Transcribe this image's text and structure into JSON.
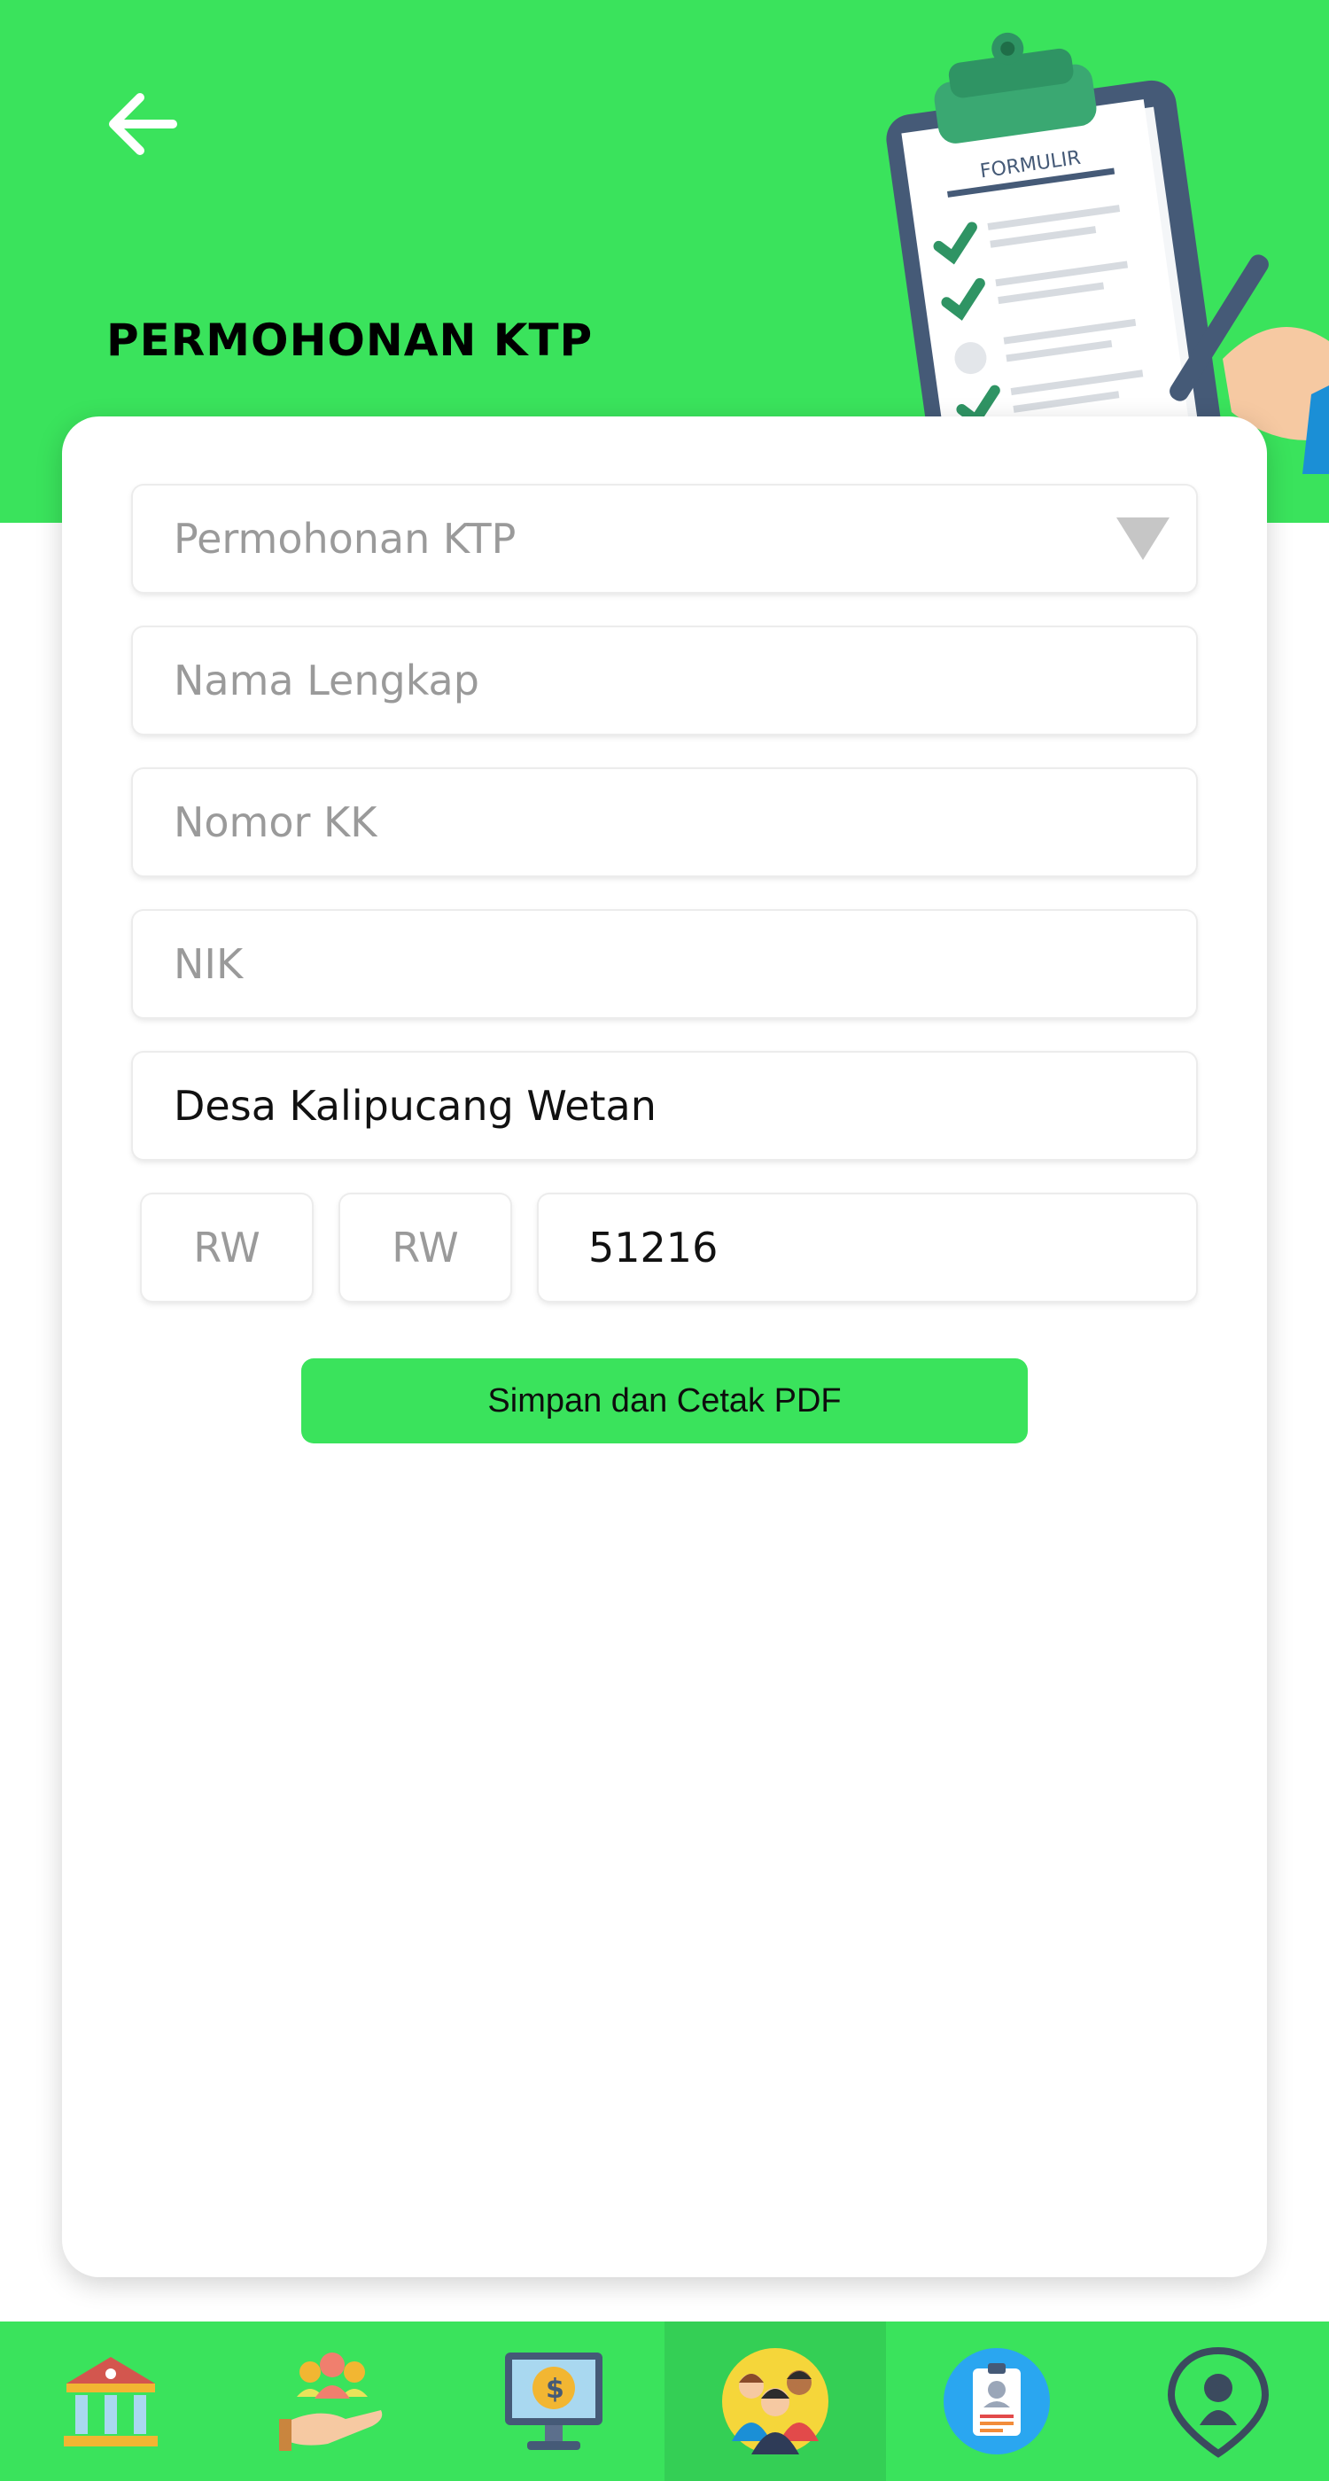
{
  "header": {
    "title": "PERMOHONAN KTP",
    "illustration_label": "FORMULIR"
  },
  "form": {
    "service_select": {
      "value": "Permohonan KTP"
    },
    "full_name": {
      "placeholder": "Nama Lengkap"
    },
    "kk_number": {
      "placeholder": "Nomor KK"
    },
    "nik": {
      "placeholder": "NIK"
    },
    "village": {
      "value": "Desa Kalipucang Wetan"
    },
    "rw_1": {
      "placeholder": "RW"
    },
    "rw_2": {
      "placeholder": "RW"
    },
    "postal_code": {
      "value": "51216"
    },
    "submit_label": "Simpan dan Cetak PDF"
  },
  "bottom_nav": {
    "items": [
      {
        "icon": "government-building-icon"
      },
      {
        "icon": "community-hand-icon"
      },
      {
        "icon": "finance-monitor-icon"
      },
      {
        "icon": "citizens-group-icon",
        "active": true
      },
      {
        "icon": "id-card-icon"
      },
      {
        "icon": "location-person-icon"
      }
    ]
  },
  "colors": {
    "primary": "#3ae35c",
    "nav_active": "#34cf55",
    "placeholder": "#9a9a9a"
  }
}
